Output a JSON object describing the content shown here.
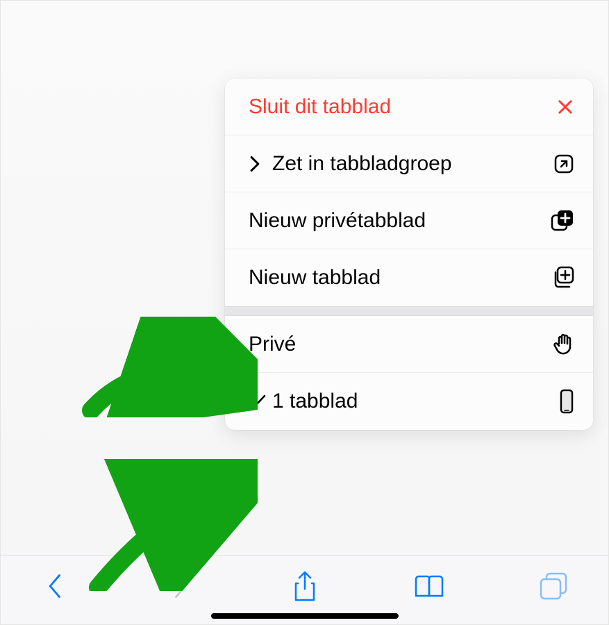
{
  "menu": {
    "close_tab_label": "Sluit dit tabblad",
    "move_to_group_label": "Zet in tabbladgroep",
    "new_private_tab_label": "Nieuw privétabblad",
    "new_tab_label": "Nieuw tabblad",
    "private_label": "Privé",
    "one_tab_label": "1 tabblad"
  },
  "colors": {
    "destructive": "#ff3b30",
    "tint": "#007aff",
    "annotation": "#11a313"
  }
}
